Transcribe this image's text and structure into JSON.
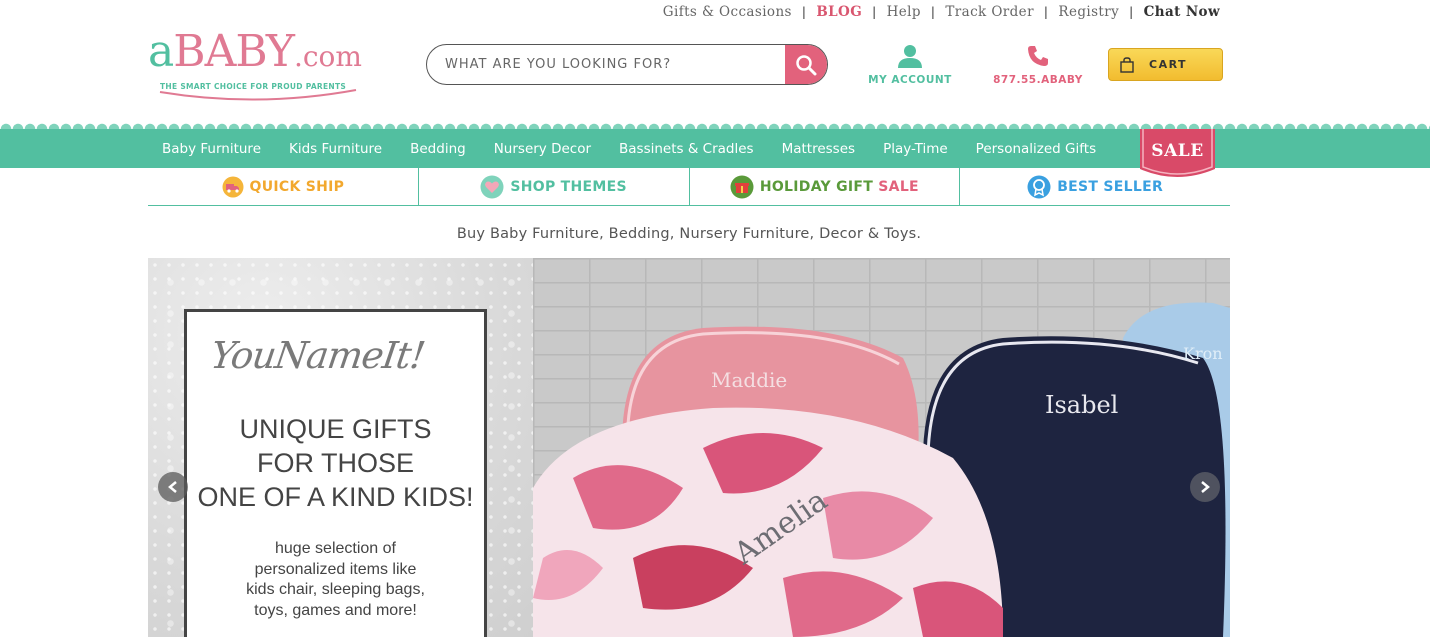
{
  "top_links": {
    "gifts": "Gifts & Occasions",
    "blog": "BLOG",
    "help": "Help",
    "track": "Track Order",
    "registry": "Registry",
    "chat": "Chat Now",
    "separator": "|"
  },
  "logo": {
    "prefix": "a",
    "main": "BABY",
    "suffix": ".com",
    "tagline": "THE SMART CHOICE FOR PROUD PARENTS"
  },
  "search": {
    "placeholder": "WHAT ARE YOU LOOKING FOR?",
    "icon": "search-icon"
  },
  "account": {
    "label": "MY ACCOUNT",
    "icon": "user-icon"
  },
  "phone": {
    "label": "877.55.ABABY",
    "icon": "phone-icon"
  },
  "cart": {
    "label": "CART",
    "icon": "shopping-bag-icon"
  },
  "main_nav": [
    "Baby Furniture",
    "Kids Furniture",
    "Bedding",
    "Nursery Decor",
    "Bassinets & Cradles",
    "Mattresses",
    "Play-Time",
    "Personalized Gifts"
  ],
  "sale_badge": "SALE",
  "feature_bar": [
    {
      "label": "QUICK SHIP",
      "icon": "truck-icon"
    },
    {
      "label": "SHOP THEMES",
      "icon": "heart-icon"
    },
    {
      "label_a": "HOLIDAY GIFT ",
      "label_b": "SALE",
      "icon": "gift-icon"
    },
    {
      "label": "BEST SELLER",
      "icon": "award-ribbon-icon"
    }
  ],
  "tagline": "Buy Baby Furniture, Bedding, Nursery Furniture, Decor & Toys.",
  "hero": {
    "script_title": "YouNameIt!",
    "headline": "UNIQUE GIFTS\nFOR THOSE\nONE OF A KIND KIDS!",
    "body": "huge selection of\npersonalized items like\nkids chair, sleeping bags,\ntoys, games and more!",
    "names": [
      "Maddie",
      "Isabel",
      "Kron",
      "Amelia"
    ]
  },
  "colors": {
    "brand_teal": "#52bfa0",
    "brand_pink": "#e2627c",
    "cart_yellow": "#f2bc2f",
    "quick_ship": "#f2a82e",
    "best_seller": "#3aa0e0"
  }
}
